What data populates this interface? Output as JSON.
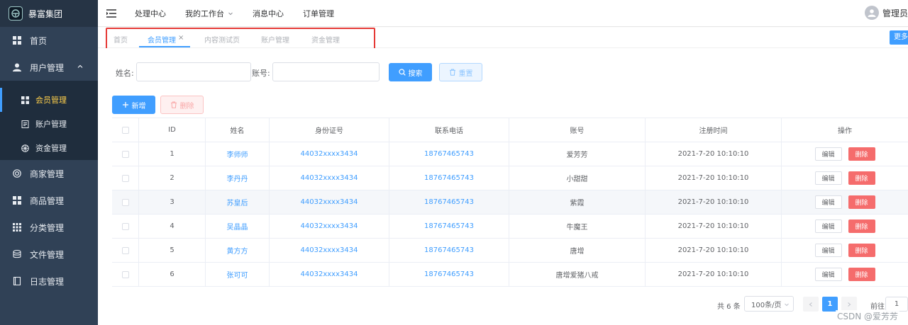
{
  "sidebar": {
    "brand": "暴富集团",
    "items": [
      {
        "label": "首页"
      },
      {
        "label": "用户管理"
      },
      {
        "label": "会员管理"
      },
      {
        "label": "账户管理"
      },
      {
        "label": "资金管理"
      },
      {
        "label": "商家管理"
      },
      {
        "label": "商品管理"
      },
      {
        "label": "分类管理"
      },
      {
        "label": "文件管理"
      },
      {
        "label": "日志管理"
      }
    ]
  },
  "topbar": {
    "nav": [
      "处理中心",
      "我的工作台",
      "消息中心",
      "订单管理"
    ],
    "user": "管理员"
  },
  "tabs": {
    "items": [
      "首页",
      "会员管理",
      "内容测试页",
      "账户管理",
      "资金管理"
    ],
    "close": "×",
    "more": "更多"
  },
  "search": {
    "name_label": "姓名:",
    "account_label": "账号:",
    "name_value": "",
    "account_value": "",
    "search_btn": "搜索",
    "reset_btn": "重置"
  },
  "actions": {
    "add_btn": "新增",
    "delete_btn": "删除"
  },
  "table": {
    "headers": [
      "ID",
      "姓名",
      "身份证号",
      "联系电话",
      "账号",
      "注册时间",
      "操作"
    ],
    "edit_label": "编辑",
    "delete_label": "删除",
    "rows": [
      {
        "id": "1",
        "name": "李师师",
        "idcard": "44032xxxx3434",
        "phone": "18767465743",
        "account": "爱芳芳",
        "time": "2021-7-20 10:10:10"
      },
      {
        "id": "2",
        "name": "李丹丹",
        "idcard": "44032xxxx3434",
        "phone": "18767465743",
        "account": "小甜甜",
        "time": "2021-7-20 10:10:10"
      },
      {
        "id": "3",
        "name": "苏皇后",
        "idcard": "44032xxxx3434",
        "phone": "18767465743",
        "account": "紫霞",
        "time": "2021-7-20 10:10:10"
      },
      {
        "id": "4",
        "name": "吴晶晶",
        "idcard": "44032xxxx3434",
        "phone": "18767465743",
        "account": "牛魔王",
        "time": "2021-7-20 10:10:10"
      },
      {
        "id": "5",
        "name": "黄方方",
        "idcard": "44032xxxx3434",
        "phone": "18767465743",
        "account": "唐增",
        "time": "2021-7-20 10:10:10"
      },
      {
        "id": "6",
        "name": "张可可",
        "idcard": "44032xxxx3434",
        "phone": "18767465743",
        "account": "唐增爱猪八戒",
        "time": "2021-7-20 10:10:10"
      }
    ]
  },
  "pagination": {
    "total": "共 6 条",
    "page_size": "100条/页",
    "current": "1",
    "goto_label": "前往",
    "goto_value": "1"
  },
  "watermark": "CSDN @爱芳芳",
  "colors": {
    "primary": "#409eff",
    "danger": "#f56c6c",
    "sidebar_bg": "#304156",
    "active_menu": "#ffd04b",
    "highlight_frame": "#e53935"
  }
}
